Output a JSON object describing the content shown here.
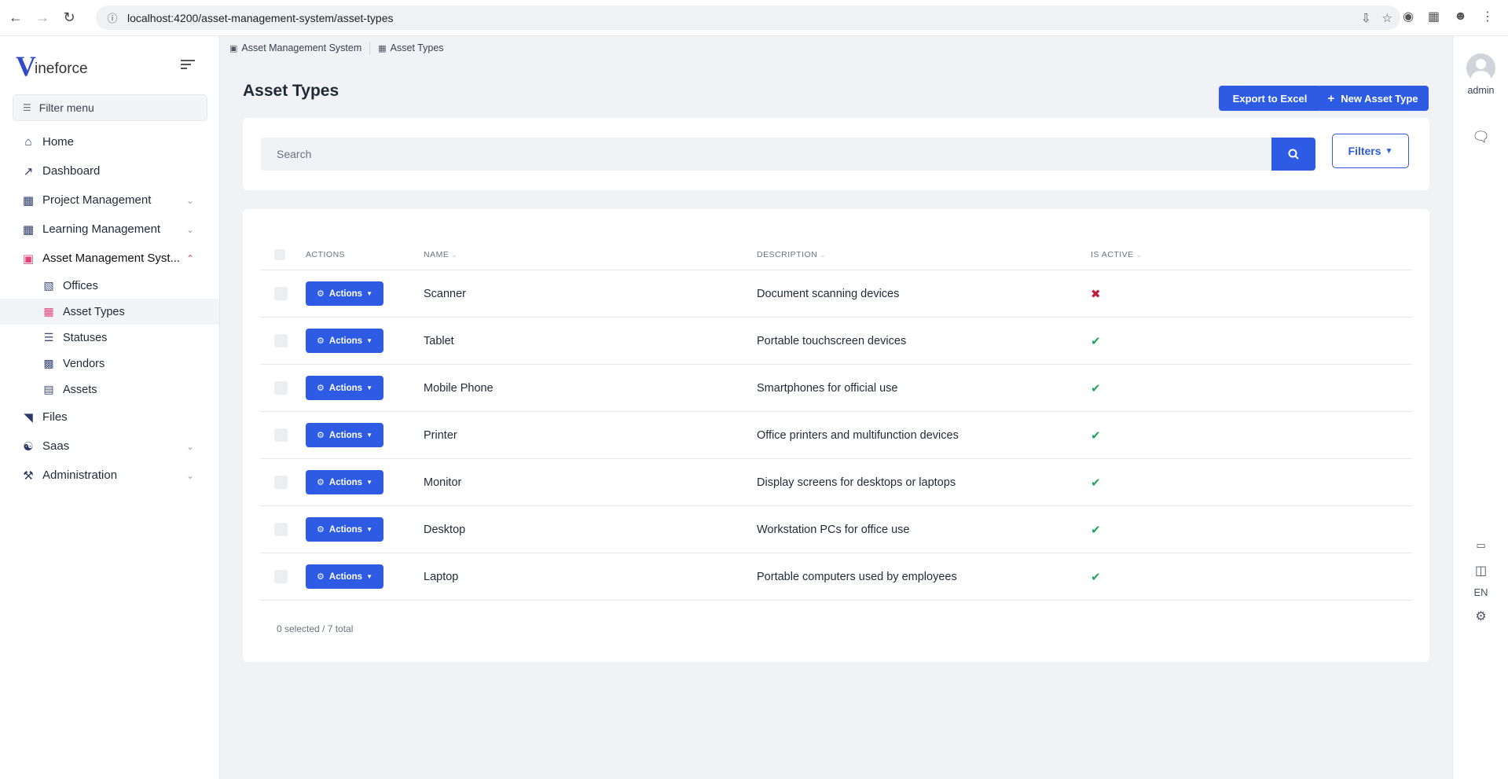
{
  "browser": {
    "url": "localhost:4200/asset-management-system/asset-types"
  },
  "sidebar": {
    "logo_initial": "V",
    "logo_text": "ineforce",
    "filter_placeholder": "Filter menu",
    "items": [
      {
        "label": "Home",
        "icon": "home-icon"
      },
      {
        "label": "Dashboard",
        "icon": "chart-line-icon"
      },
      {
        "label": "Project Management",
        "icon": "sitemap-icon"
      },
      {
        "label": "Learning Management",
        "icon": "sitemap-icon"
      },
      {
        "label": "Asset Management Syst...",
        "icon": "box-icon"
      },
      {
        "label": "Files",
        "icon": "folder-open-icon"
      },
      {
        "label": "Saas",
        "icon": "users-icon"
      },
      {
        "label": "Administration",
        "icon": "wrench-icon"
      }
    ],
    "sub_items": [
      {
        "label": "Offices",
        "icon": "building-icon"
      },
      {
        "label": "Asset Types",
        "icon": "grid-icon"
      },
      {
        "label": "Statuses",
        "icon": "list-check-icon"
      },
      {
        "label": "Vendors",
        "icon": "store-icon"
      },
      {
        "label": "Assets",
        "icon": "cash-register-icon"
      }
    ]
  },
  "breadcrumb": {
    "items": [
      "Asset Management System",
      "Asset Types"
    ]
  },
  "page": {
    "title": "Asset Types",
    "export_label": "Export to Excel",
    "new_label": "New Asset Type"
  },
  "search": {
    "placeholder": "Search",
    "filters_label": "Filters"
  },
  "table": {
    "columns": [
      "ACTIONS",
      "NAME",
      "DESCRIPTION",
      "IS ACTIVE"
    ],
    "action_label": "Actions",
    "rows": [
      {
        "name": "Scanner",
        "description": "Document scanning devices",
        "active": false
      },
      {
        "name": "Tablet",
        "description": "Portable touchscreen devices",
        "active": true
      },
      {
        "name": "Mobile Phone",
        "description": "Smartphones for official use",
        "active": true
      },
      {
        "name": "Printer",
        "description": "Office printers and multifunction devices",
        "active": true
      },
      {
        "name": "Monitor",
        "description": "Display screens for desktops or laptops",
        "active": true
      },
      {
        "name": "Desktop",
        "description": "Workstation PCs for office use",
        "active": true
      },
      {
        "name": "Laptop",
        "description": "Portable computers used by employees",
        "active": true
      }
    ],
    "footer": "0 selected / 7 total"
  },
  "rail": {
    "user": "admin",
    "language": "EN"
  },
  "colors": {
    "primary": "#2d5be3",
    "accent": "#e0447a",
    "success": "#22a55b",
    "danger": "#c8173d"
  }
}
